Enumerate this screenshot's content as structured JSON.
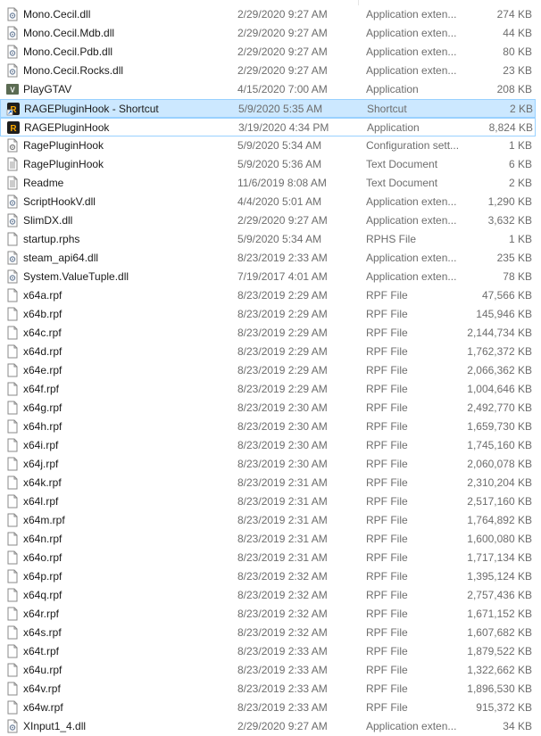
{
  "rows": [
    {
      "name": "Mono.Cecil.dll",
      "date": "2/29/2020 9:27 AM",
      "type": "Application exten...",
      "size": "274 KB",
      "icon": "dll-icon"
    },
    {
      "name": "Mono.Cecil.Mdb.dll",
      "date": "2/29/2020 9:27 AM",
      "type": "Application exten...",
      "size": "44 KB",
      "icon": "dll-icon"
    },
    {
      "name": "Mono.Cecil.Pdb.dll",
      "date": "2/29/2020 9:27 AM",
      "type": "Application exten...",
      "size": "80 KB",
      "icon": "dll-icon"
    },
    {
      "name": "Mono.Cecil.Rocks.dll",
      "date": "2/29/2020 9:27 AM",
      "type": "Application exten...",
      "size": "23 KB",
      "icon": "dll-icon"
    },
    {
      "name": "PlayGTAV",
      "date": "4/15/2020 7:00 AM",
      "type": "Application",
      "size": "208 KB",
      "icon": "gtav-app-icon"
    },
    {
      "name": "RAGEPluginHook - Shortcut",
      "date": "5/9/2020 5:35 AM",
      "type": "Shortcut",
      "size": "2 KB",
      "icon": "rage-shortcut-icon",
      "state": "selected"
    },
    {
      "name": "RAGEPluginHook",
      "date": "3/19/2020 4:34 PM",
      "type": "Application",
      "size": "8,824 KB",
      "icon": "rage-app-icon",
      "state": "hover"
    },
    {
      "name": "RagePluginHook",
      "date": "5/9/2020 5:34 AM",
      "type": "Configuration sett...",
      "size": "1 KB",
      "icon": "config-file-icon"
    },
    {
      "name": "RagePluginHook",
      "date": "5/9/2020 5:36 AM",
      "type": "Text Document",
      "size": "6 KB",
      "icon": "text-file-icon"
    },
    {
      "name": "Readme",
      "date": "11/6/2019 8:08 AM",
      "type": "Text Document",
      "size": "2 KB",
      "icon": "text-file-icon"
    },
    {
      "name": "ScriptHookV.dll",
      "date": "4/4/2020 5:01 AM",
      "type": "Application exten...",
      "size": "1,290 KB",
      "icon": "dll-icon"
    },
    {
      "name": "SlimDX.dll",
      "date": "2/29/2020 9:27 AM",
      "type": "Application exten...",
      "size": "3,632 KB",
      "icon": "dll-icon"
    },
    {
      "name": "startup.rphs",
      "date": "5/9/2020 5:34 AM",
      "type": "RPHS File",
      "size": "1 KB",
      "icon": "blank-file-icon"
    },
    {
      "name": "steam_api64.dll",
      "date": "8/23/2019 2:33 AM",
      "type": "Application exten...",
      "size": "235 KB",
      "icon": "dll-icon"
    },
    {
      "name": "System.ValueTuple.dll",
      "date": "7/19/2017 4:01 AM",
      "type": "Application exten...",
      "size": "78 KB",
      "icon": "dll-icon"
    },
    {
      "name": "x64a.rpf",
      "date": "8/23/2019 2:29 AM",
      "type": "RPF File",
      "size": "47,566 KB",
      "icon": "blank-file-icon"
    },
    {
      "name": "x64b.rpf",
      "date": "8/23/2019 2:29 AM",
      "type": "RPF File",
      "size": "145,946 KB",
      "icon": "blank-file-icon"
    },
    {
      "name": "x64c.rpf",
      "date": "8/23/2019 2:29 AM",
      "type": "RPF File",
      "size": "2,144,734 KB",
      "icon": "blank-file-icon"
    },
    {
      "name": "x64d.rpf",
      "date": "8/23/2019 2:29 AM",
      "type": "RPF File",
      "size": "1,762,372 KB",
      "icon": "blank-file-icon"
    },
    {
      "name": "x64e.rpf",
      "date": "8/23/2019 2:29 AM",
      "type": "RPF File",
      "size": "2,066,362 KB",
      "icon": "blank-file-icon"
    },
    {
      "name": "x64f.rpf",
      "date": "8/23/2019 2:29 AM",
      "type": "RPF File",
      "size": "1,004,646 KB",
      "icon": "blank-file-icon"
    },
    {
      "name": "x64g.rpf",
      "date": "8/23/2019 2:30 AM",
      "type": "RPF File",
      "size": "2,492,770 KB",
      "icon": "blank-file-icon"
    },
    {
      "name": "x64h.rpf",
      "date": "8/23/2019 2:30 AM",
      "type": "RPF File",
      "size": "1,659,730 KB",
      "icon": "blank-file-icon"
    },
    {
      "name": "x64i.rpf",
      "date": "8/23/2019 2:30 AM",
      "type": "RPF File",
      "size": "1,745,160 KB",
      "icon": "blank-file-icon"
    },
    {
      "name": "x64j.rpf",
      "date": "8/23/2019 2:30 AM",
      "type": "RPF File",
      "size": "2,060,078 KB",
      "icon": "blank-file-icon"
    },
    {
      "name": "x64k.rpf",
      "date": "8/23/2019 2:31 AM",
      "type": "RPF File",
      "size": "2,310,204 KB",
      "icon": "blank-file-icon"
    },
    {
      "name": "x64l.rpf",
      "date": "8/23/2019 2:31 AM",
      "type": "RPF File",
      "size": "2,517,160 KB",
      "icon": "blank-file-icon"
    },
    {
      "name": "x64m.rpf",
      "date": "8/23/2019 2:31 AM",
      "type": "RPF File",
      "size": "1,764,892 KB",
      "icon": "blank-file-icon"
    },
    {
      "name": "x64n.rpf",
      "date": "8/23/2019 2:31 AM",
      "type": "RPF File",
      "size": "1,600,080 KB",
      "icon": "blank-file-icon"
    },
    {
      "name": "x64o.rpf",
      "date": "8/23/2019 2:31 AM",
      "type": "RPF File",
      "size": "1,717,134 KB",
      "icon": "blank-file-icon"
    },
    {
      "name": "x64p.rpf",
      "date": "8/23/2019 2:32 AM",
      "type": "RPF File",
      "size": "1,395,124 KB",
      "icon": "blank-file-icon"
    },
    {
      "name": "x64q.rpf",
      "date": "8/23/2019 2:32 AM",
      "type": "RPF File",
      "size": "2,757,436 KB",
      "icon": "blank-file-icon"
    },
    {
      "name": "x64r.rpf",
      "date": "8/23/2019 2:32 AM",
      "type": "RPF File",
      "size": "1,671,152 KB",
      "icon": "blank-file-icon"
    },
    {
      "name": "x64s.rpf",
      "date": "8/23/2019 2:32 AM",
      "type": "RPF File",
      "size": "1,607,682 KB",
      "icon": "blank-file-icon"
    },
    {
      "name": "x64t.rpf",
      "date": "8/23/2019 2:33 AM",
      "type": "RPF File",
      "size": "1,879,522 KB",
      "icon": "blank-file-icon"
    },
    {
      "name": "x64u.rpf",
      "date": "8/23/2019 2:33 AM",
      "type": "RPF File",
      "size": "1,322,662 KB",
      "icon": "blank-file-icon"
    },
    {
      "name": "x64v.rpf",
      "date": "8/23/2019 2:33 AM",
      "type": "RPF File",
      "size": "1,896,530 KB",
      "icon": "blank-file-icon"
    },
    {
      "name": "x64w.rpf",
      "date": "8/23/2019 2:33 AM",
      "type": "RPF File",
      "size": "915,372 KB",
      "icon": "blank-file-icon"
    },
    {
      "name": "XInput1_4.dll",
      "date": "2/29/2020 9:27 AM",
      "type": "Application exten...",
      "size": "34 KB",
      "icon": "dll-icon"
    }
  ],
  "colors": {
    "selected_bg": "#cce8ff",
    "selected_border": "#99d1ff",
    "secondary_text": "#6d6d6d",
    "rage_icon_bg": "#1e1e1e",
    "rage_icon_fg": "#f7a600"
  }
}
